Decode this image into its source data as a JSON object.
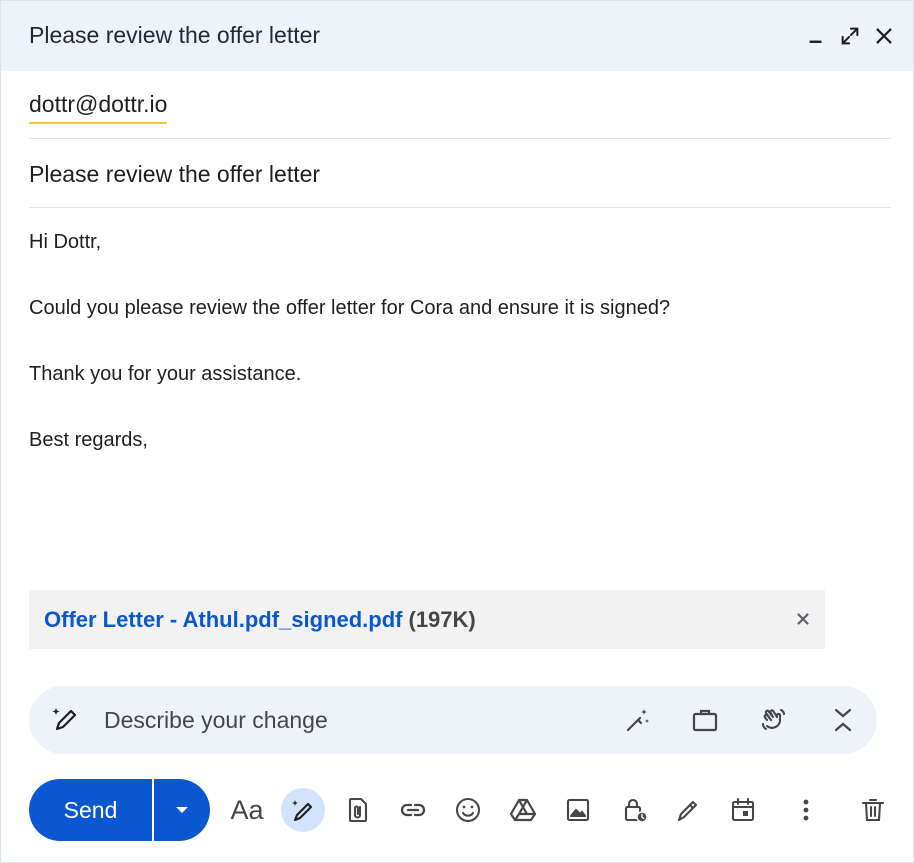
{
  "window": {
    "title": "Please review the offer letter",
    "controls": {
      "minimize": "minimize-icon",
      "expand": "expand-icon",
      "close": "close-icon"
    }
  },
  "recipient": {
    "to": "dottr@dottr.io"
  },
  "subject": "Please review the offer letter",
  "body": {
    "lines": [
      "Hi Dottr,",
      "Could you please review the offer letter for Cora and ensure it is signed?",
      "Thank you for your assistance.",
      "Best regards,"
    ]
  },
  "attachment": {
    "name": "Offer Letter - Athul.pdf_signed.pdf",
    "size": "(197K)"
  },
  "ai_bar": {
    "placeholder": "Describe your change",
    "icons": [
      "pen-sparkle-icon",
      "magic-wand-icon",
      "briefcase-icon",
      "wave-hand-icon",
      "collapse-icon"
    ]
  },
  "toolbar": {
    "send_label": "Send",
    "format_label": "Aa",
    "icons": [
      "formatting-icon",
      "help-me-write-icon",
      "attach-icon",
      "link-icon",
      "emoji-icon",
      "drive-icon",
      "photo-icon",
      "confidential-icon",
      "signature-icon",
      "schedule-icon",
      "more-options-icon",
      "discard-icon"
    ]
  },
  "colors": {
    "accent": "#0b57d0",
    "header_bg": "#eef2f9",
    "active_bg": "#d3e3fd",
    "icon": "#444746",
    "underline": "#f5c542"
  }
}
